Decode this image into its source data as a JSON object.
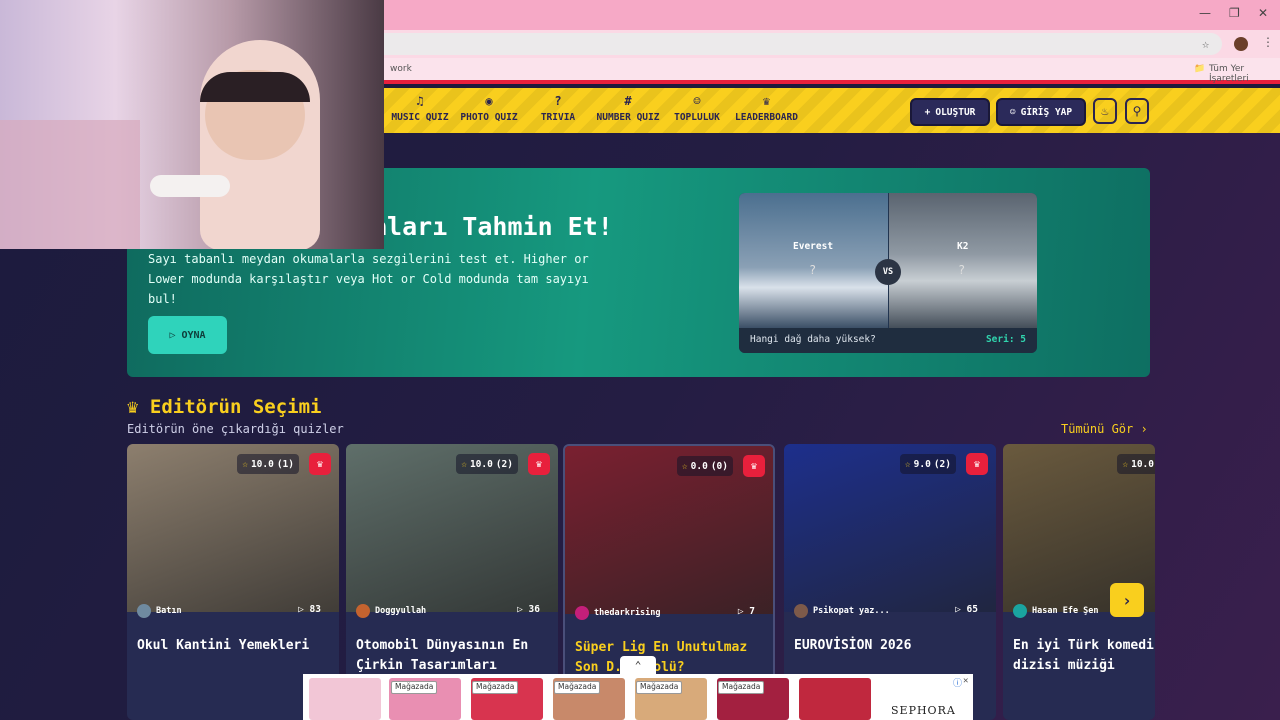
{
  "browser": {
    "bookmark_partial": "work",
    "bookmarks_all": "Tüm Yer İşaretleri",
    "window_controls": [
      "minimize-icon",
      "restore-icon",
      "close-icon"
    ]
  },
  "nav": {
    "items": [
      {
        "label": "MUSIC QUIZ",
        "icon": "music-note-icon"
      },
      {
        "label": "PHOTO QUIZ",
        "icon": "camera-icon"
      },
      {
        "label": "TRIVIA",
        "icon": "question-bubble-icon"
      },
      {
        "label": "NUMBER QUIZ",
        "icon": "hash-icon"
      },
      {
        "label": "TOPLULUK",
        "icon": "users-icon"
      },
      {
        "label": "LEADERBOARD",
        "icon": "trophy-icon"
      }
    ],
    "create_label": "OLUŞTUR",
    "login_label": "GİRİŞ YAP"
  },
  "hero": {
    "title_visible": "aları Tahmin Et!",
    "description": "Sayı tabanlı meydan okumalarla sezgilerini test et. Higher or Lower modunda karşılaştır veya Hot or Cold modunda tam sayıyı bul!",
    "play_label": "OYNA",
    "preview": {
      "left_name": "Everest",
      "right_name": "K2",
      "unknown": "?",
      "vs": "VS",
      "question": "Hangi dağ daha yüksek?",
      "streak": "Seri: 5"
    }
  },
  "editors_pick": {
    "title": "Editörün Seçimi",
    "subtitle": "Editörün öne çıkardığı quizler",
    "see_all": "Tümünü Gör ›",
    "cards": [
      {
        "rating": "10.0",
        "count": "(1)",
        "author": "Batın",
        "plays": "83",
        "title": "Okul Kantini Yemekleri",
        "thumb": "#8d7f6e",
        "avatar": "#6f8aa0"
      },
      {
        "rating": "10.0",
        "count": "(2)",
        "author": "Doggyullah",
        "plays": "36",
        "title": "Otomobil Dünyasının En Çirkin Tasarımları",
        "thumb": "#5f6f6a",
        "avatar": "#c4632f"
      },
      {
        "rating": "0.0",
        "count": "(0)",
        "author": "thedarkrising",
        "plays": "7",
        "title": "Süper Lig En Unutulmaz Son D... Golü?",
        "thumb": "#7a2030",
        "avatar": "#c41f7a"
      },
      {
        "rating": "9.0",
        "count": "(2)",
        "author": "Psikopat yaz...",
        "plays": "65",
        "title": "EUROVİSİON 2026",
        "thumb": "#1d2f8c",
        "avatar": "#7d5a4a"
      },
      {
        "rating": "10.0",
        "count": "",
        "author": "Hasan Efe Şen",
        "plays": "",
        "title": "En iyi Türk komedi dizisi müziği",
        "thumb": "#6a5a3e",
        "avatar": "#1aa4a0"
      }
    ]
  },
  "ad": {
    "label": "Mağazada",
    "brand": "SEPHORA"
  }
}
